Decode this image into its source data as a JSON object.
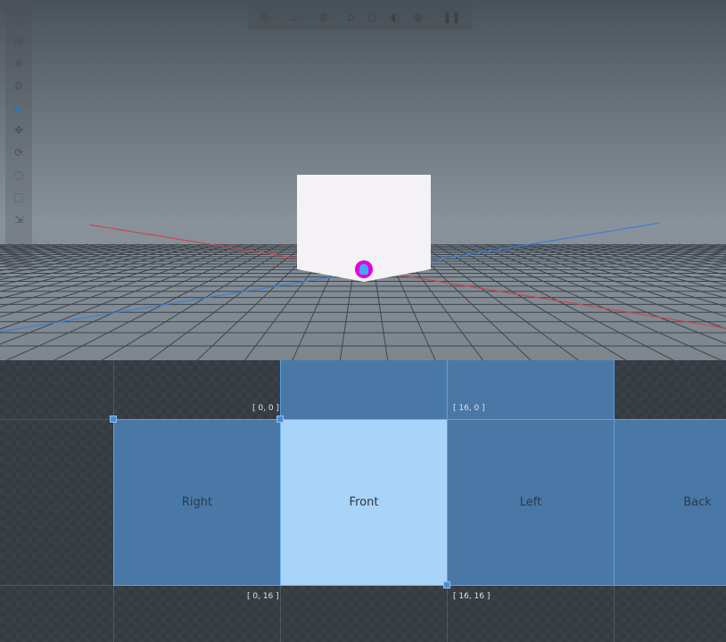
{
  "viewport": {
    "top_toolbar": [
      {
        "icon": "display-mode-icon",
        "has_menu": true
      },
      {
        "icon": "transform-space-icon",
        "has_menu": true
      },
      {
        "icon": "mirror-modeling-icon",
        "has_menu": true
      },
      {
        "icon": "snap-icon",
        "has_menu": false
      },
      {
        "icon": "sphere-outline-icon",
        "has_menu": false
      },
      {
        "icon": "shading-icon",
        "has_menu": false
      },
      {
        "icon": "globe-icon",
        "has_menu": true
      },
      {
        "icon": "footprints-icon",
        "has_menu": false
      }
    ],
    "left_toolbar": [
      {
        "icon": "hierarchy-icon",
        "active": false
      },
      {
        "icon": "add-cube-icon",
        "active": false
      },
      {
        "icon": "add-group-icon",
        "active": false
      },
      {
        "icon": "settings-icon",
        "active": false
      },
      {
        "icon": "cursor-icon",
        "active": true
      },
      {
        "icon": "move-icon",
        "active": false
      },
      {
        "icon": "rotate-icon",
        "active": false
      },
      {
        "icon": "pivot-icon",
        "active": false
      },
      {
        "icon": "resize-icon",
        "active": false
      },
      {
        "icon": "stretch-icon",
        "active": false
      }
    ],
    "colors": {
      "axis_x": "#c8484f",
      "axis_z": "#3a7fd6",
      "pivot": "#e000e0"
    }
  },
  "uv_editor": {
    "faces": [
      {
        "label": "Right",
        "selected": false
      },
      {
        "label": "Front",
        "selected": true
      },
      {
        "label": "Left",
        "selected": false
      },
      {
        "label": "Back",
        "selected": false
      }
    ],
    "coords": {
      "top_left": "[ 0, 0 ]",
      "top_right": "[ 16, 0 ]",
      "bottom_left": "[ 0, 16 ]",
      "bottom_right": "[ 16, 16 ]"
    },
    "colors": {
      "face": "#4a78a6",
      "face_selected": "#a8d4fa",
      "face_border": "#5aa0e0"
    }
  }
}
